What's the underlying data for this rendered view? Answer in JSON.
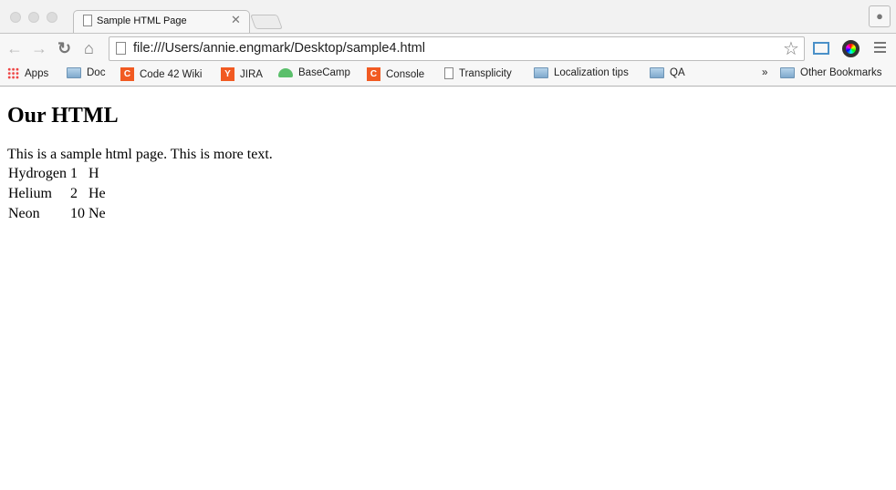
{
  "browser": {
    "tab_title": "Sample HTML Page",
    "url": "file:///Users/annie.engmark/Desktop/sample4.html",
    "bookmarks": [
      {
        "label": "Apps",
        "icon": "apps-grid-icon"
      },
      {
        "label": "Doc",
        "icon": "folder-icon"
      },
      {
        "label": "Code 42 Wiki",
        "icon": "code42-icon"
      },
      {
        "label": "JIRA",
        "icon": "jira-icon"
      },
      {
        "label": "BaseCamp",
        "icon": "basecamp-icon"
      },
      {
        "label": "Console",
        "icon": "code42-icon"
      },
      {
        "label": "Transplicity",
        "icon": "page-icon"
      },
      {
        "label": "Localization tips",
        "icon": "folder-icon"
      },
      {
        "label": "QA",
        "icon": "folder-icon"
      }
    ],
    "overflow": "»",
    "other_bookmarks": "Other Bookmarks"
  },
  "page": {
    "heading": "Our HTML",
    "paragraph": "This is a sample html page. This is more text.",
    "table": [
      [
        "Hydrogen",
        "1",
        "H"
      ],
      [
        "Helium",
        "2",
        "He"
      ],
      [
        "Neon",
        "10",
        "Ne"
      ]
    ]
  }
}
